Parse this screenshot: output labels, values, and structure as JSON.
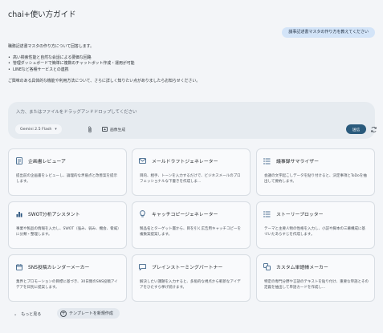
{
  "title": "chai+使い方ガイド",
  "user_message": "議事記述書マスタの作り方を教えてください",
  "reply": {
    "intro": "職務記述書マスタの作り方について回答します。",
    "bullets": [
      "高い検索性能と自然な会話による要価な回路",
      "管理ダッシュボードで簡単に複数のチャットボット作成・運用が可能",
      "LINEなど各種サービスとの連携"
    ],
    "outro": "ご興味のある具体的な機能や利用方法について、さらに詳しく知りたい点がありましたらお知らせください。"
  },
  "composer": {
    "placeholder": "入力、またはファイルをドラッグアンドドロップしてください",
    "model": "Gemini 2.5 Flash",
    "image_gen": "画像生成",
    "send": "送信"
  },
  "cards": [
    {
      "icon": "document-icon",
      "title": "企画書レビューア",
      "desc": "提出前の企画書をレビューし、論理的な矛盾点と改善案を提示します。"
    },
    {
      "icon": "mail-icon",
      "title": "メールドラフトジェネレーター",
      "desc": "目的、相手、トーンを入力するだけで、ビジネスメールのプロフェッショナルな下書きを作成しま..."
    },
    {
      "icon": "list-icon",
      "title": "議事録サマライザー",
      "desc": "会議の文字起こしデータを貼り付けると、決定事項とToDoを抽出して要約します。"
    },
    {
      "icon": "bar-chart-icon",
      "title": "SWOT分析アシスタント",
      "desc": "事業や製品の情報を入力し、SWOT（強み、弱み、機会、脅威）に分類・整理します。"
    },
    {
      "icon": "lightbulb-icon",
      "title": "キャッチコピージェネレーター",
      "desc": "製品名とターゲット層から、目を引く広告用キャッチコピーを複数案提案します。"
    },
    {
      "icon": "list-icon",
      "title": "ストーリープロッター",
      "desc": "テーマと主要人物の性格を入力し、小説や脚本の三幕構成に基づいたあらすじを作成します。"
    },
    {
      "icon": "calendar-icon",
      "title": "SNS投稿カレンダーメーカー",
      "desc": "業界とプロモーションの目標に基づき、30日間のSNS投稿アイデアを日別に提案します。"
    },
    {
      "icon": "chat-bubble-icon",
      "title": "ブレインストーミングパートナー",
      "desc": "解決したい課題を入力すると、多角的な視点から斬新なアイデアをひたすら挙げ続けます。"
    },
    {
      "icon": "translate-icon",
      "title": "カスタム単語帳メーカー",
      "desc": "特定の専門分野や言語のテキストを貼り付け、重要な単語とその定義を抽出して単語カードを作成し..."
    }
  ],
  "footer": {
    "more": "もっと見る",
    "new_template": "テンプレートを新規作成"
  },
  "colors": {
    "accent": "#2a5a7c",
    "user_bubble": "#d3e4f8",
    "background": "#f3f5f8"
  }
}
